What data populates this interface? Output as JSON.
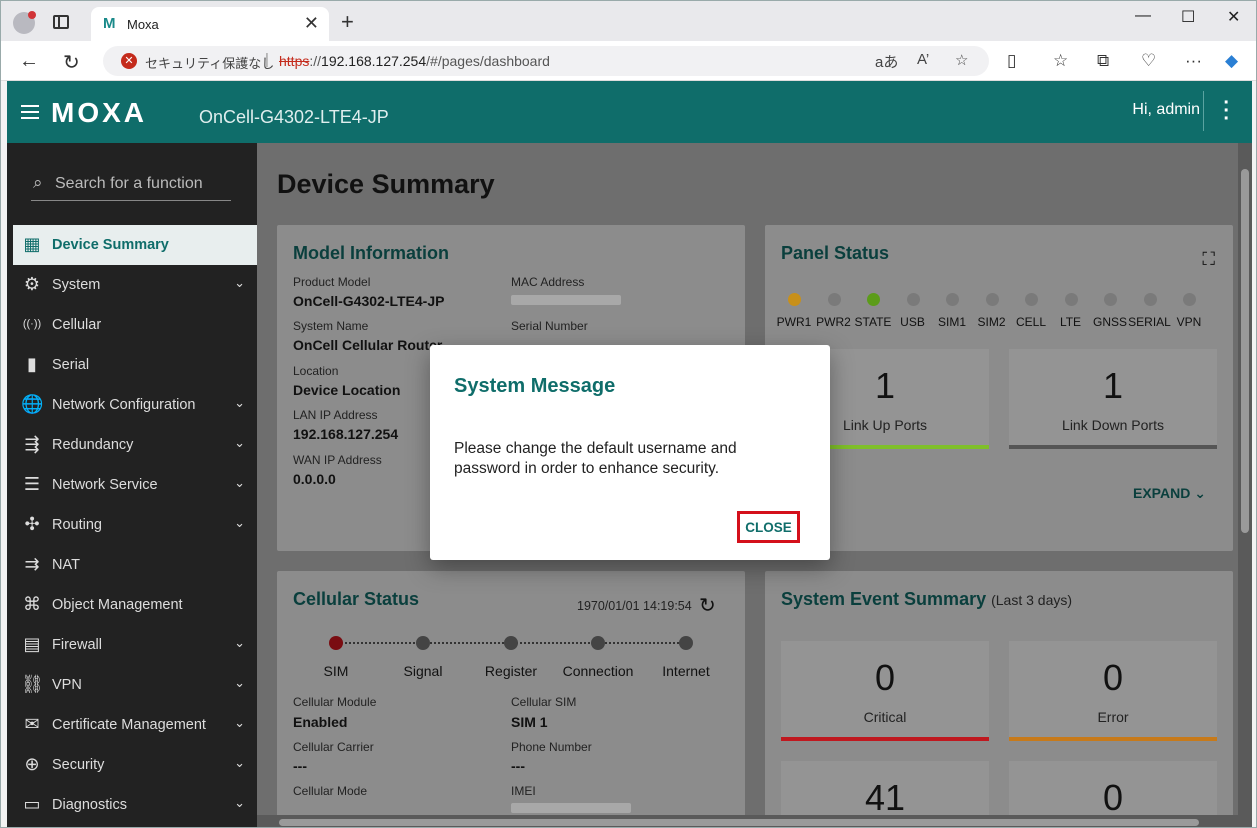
{
  "browser": {
    "tab_title": "Moxa",
    "tab_favicon": "M",
    "security_label": "セキュリティ保護なし",
    "url_scheme": "https",
    "url_rest": "://192.168.127.254/#/pages/dashboard",
    "url_host": "192.168.127.254",
    "url_path": "/#/pages/dashboard",
    "reader_label": "aあ",
    "read_aloud_label": "A’"
  },
  "app": {
    "brand": "MOXA",
    "model": "OnCell-G4302-LTE4-JP",
    "greeting": "Hi, admin"
  },
  "sidebar": {
    "search_placeholder": "Search for a function",
    "items": [
      {
        "label": "Device Summary",
        "icon": "dashboard-icon",
        "expandable": false,
        "active": true
      },
      {
        "label": "System",
        "icon": "gear-icon",
        "expandable": true
      },
      {
        "label": "Cellular",
        "icon": "antenna-icon",
        "expandable": false
      },
      {
        "label": "Serial",
        "icon": "serial-icon",
        "expandable": false
      },
      {
        "label": "Network Configuration",
        "icon": "globe-gear-icon",
        "expandable": true
      },
      {
        "label": "Redundancy",
        "icon": "redundancy-icon",
        "expandable": true
      },
      {
        "label": "Network Service",
        "icon": "server-icon",
        "expandable": true
      },
      {
        "label": "Routing",
        "icon": "routing-icon",
        "expandable": true
      },
      {
        "label": "NAT",
        "icon": "nat-icon",
        "expandable": false
      },
      {
        "label": "Object Management",
        "icon": "object-icon",
        "expandable": false
      },
      {
        "label": "Firewall",
        "icon": "firewall-icon",
        "expandable": true
      },
      {
        "label": "VPN",
        "icon": "vpn-icon",
        "expandable": true
      },
      {
        "label": "Certificate Management",
        "icon": "certificate-icon",
        "expandable": true
      },
      {
        "label": "Security",
        "icon": "security-icon",
        "expandable": true
      },
      {
        "label": "Diagnostics",
        "icon": "diagnostics-icon",
        "expandable": true
      }
    ]
  },
  "main": {
    "page_title": "Device Summary",
    "model_info": {
      "title": "Model Information",
      "product_model_label": "Product Model",
      "product_model": "OnCell-G4302-LTE4-JP",
      "mac_label": "MAC Address",
      "system_name_label": "System Name",
      "system_name": "OnCell Cellular Router",
      "serial_label": "Serial Number",
      "location_label": "Location",
      "location": "Device Location",
      "lan_label": "LAN IP Address",
      "lan_ip": "192.168.127.254",
      "wan_label": "WAN IP Address",
      "wan_ip": "0.0.0.0"
    },
    "panel_status": {
      "title": "Panel Status",
      "leds": [
        {
          "label": "PWR1",
          "color": "#c8901a"
        },
        {
          "label": "PWR2",
          "color": "#7a7a7a"
        },
        {
          "label": "STATE",
          "color": "#5c9c1a"
        },
        {
          "label": "USB",
          "color": "#7a7a7a"
        },
        {
          "label": "SIM1",
          "color": "#7a7a7a"
        },
        {
          "label": "SIM2",
          "color": "#7a7a7a"
        },
        {
          "label": "CELL",
          "color": "#7a7a7a"
        },
        {
          "label": "LTE",
          "color": "#7a7a7a"
        },
        {
          "label": "GNSS",
          "color": "#7a7a7a"
        },
        {
          "label": "SERIAL",
          "color": "#7a7a7a"
        },
        {
          "label": "VPN",
          "color": "#7a7a7a"
        }
      ],
      "link_up_count": "1",
      "link_up_label": "Link Up Ports",
      "link_down_count": "1",
      "link_down_label": "Link Down Ports",
      "expand_label": "EXPAND"
    },
    "cellular_status": {
      "title": "Cellular Status",
      "timestamp": "1970/01/01 14:19:54",
      "steps": [
        "SIM",
        "Signal",
        "Register",
        "Connection",
        "Internet"
      ],
      "module_label": "Cellular Module",
      "module": "Enabled",
      "sim_label": "Cellular SIM",
      "sim": "SIM 1",
      "carrier_label": "Cellular Carrier",
      "carrier": "---",
      "phone_label": "Phone Number",
      "phone": "---",
      "mode_label": "Cellular Mode",
      "imei_label": "IMEI"
    },
    "event_summary": {
      "title": "System Event Summary",
      "subtitle": "(Last 3 days)",
      "critical_count": "0",
      "critical_label": "Critical",
      "error_count": "0",
      "error_label": "Error",
      "third_count": "41",
      "fourth_count": "0"
    }
  },
  "dialog": {
    "title": "System Message",
    "message": "Please change the default username and password in order to enhance security.",
    "close_label": "CLOSE"
  },
  "colors": {
    "brand": "#0f6d6a",
    "link_up_bar": "#7fbf2a",
    "link_down_bar": "#555555",
    "critical_bar": "#c0181f",
    "error_bar": "#c77a1a",
    "highlight": "#d4101b"
  }
}
